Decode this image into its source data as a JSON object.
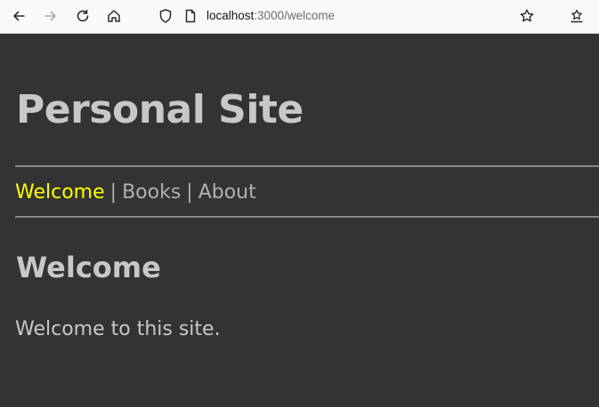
{
  "browser": {
    "url_host": "localhost",
    "url_path": ":3000/welcome",
    "icons": [
      "back-arrow-icon",
      "forward-arrow-icon",
      "reload-icon",
      "home-icon",
      "shield-icon",
      "page-icon",
      "star-icon",
      "extensions-icon"
    ]
  },
  "site": {
    "title": "Personal Site"
  },
  "nav": {
    "items": [
      {
        "label": "Welcome",
        "active": true
      },
      {
        "label": "Books",
        "active": false
      },
      {
        "label": "About",
        "active": false
      }
    ],
    "separator": "|"
  },
  "main": {
    "heading": "Welcome",
    "text": "Welcome to this site."
  },
  "colors": {
    "background": "#333333",
    "text": "#c8c8c8",
    "active_link": "#ffff00",
    "link": "#b0b0b0"
  }
}
